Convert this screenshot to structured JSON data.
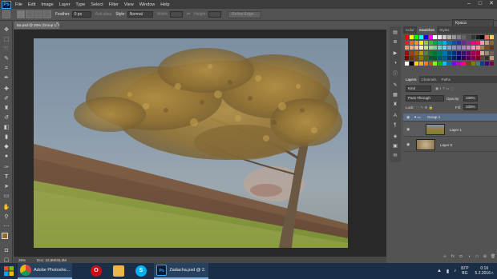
{
  "menubar": {
    "logo": "Ps",
    "items": [
      "File",
      "Edit",
      "Image",
      "Layer",
      "Type",
      "Select",
      "Filter",
      "View",
      "Window",
      "Help"
    ],
    "min": "–",
    "max": "□",
    "close": "✕"
  },
  "options": {
    "feather_label": "Feather:",
    "feather_value": "0 px",
    "antialias_label": "Anti-alias",
    "style_label": "Style:",
    "style_value": "Normal",
    "width_label": "Width:",
    "height_label": "Height:",
    "refine_edge": "Refine Edge...",
    "workspace": "Краса"
  },
  "document": {
    "tab_title": "Ба.psd @ 25% (Group 1, RGB/8)",
    "close": "×",
    "zoom": "25%",
    "doc_size": "Doc: 22,8M/45,3M"
  },
  "swatches_panel": {
    "tabs": [
      "Color",
      "Swatches",
      "Styles"
    ],
    "active": "Swatches",
    "colors": [
      "#ff0000",
      "#ffff00",
      "#00ff00",
      "#00ffff",
      "#0000ff",
      "#ff00ff",
      "#ffffff",
      "#e6e6e6",
      "#cccccc",
      "#b3b3b3",
      "#999999",
      "#808080",
      "#666666",
      "#4d4d4d",
      "#333333",
      "#1a1a1a",
      "#000000",
      "#ff6666",
      "#ffcc66",
      "#ed1c24",
      "#f26522",
      "#f7941d",
      "#fff200",
      "#8dc63f",
      "#39b54a",
      "#00a651",
      "#00a99d",
      "#00aeef",
      "#0072bc",
      "#0054a6",
      "#2e3192",
      "#662d91",
      "#92278f",
      "#ec008c",
      "#ed145b",
      "#f49ac1",
      "#c69c6d",
      "#8c6239",
      "#f69679",
      "#f9ad81",
      "#fdc689",
      "#fff799",
      "#c4df9b",
      "#a3d39c",
      "#82ca9d",
      "#7accc8",
      "#6dcff6",
      "#7da7d9",
      "#8393ca",
      "#8781bd",
      "#a186be",
      "#bd8cbf",
      "#f49ac2",
      "#f6989d",
      "#a67c52",
      "#754c24",
      "#603913",
      "#9e0b0f",
      "#a0410d",
      "#a3620a",
      "#aba000",
      "#598527",
      "#1a7b30",
      "#007236",
      "#00746b",
      "#0076a3",
      "#004a80",
      "#003471",
      "#1b1464",
      "#440e62",
      "#630460",
      "#9e005d",
      "#9e0039",
      "#c7b299",
      "#998675",
      "#736357",
      "#790000",
      "#7b2e00",
      "#7d4900",
      "#827b00",
      "#406618",
      "#005e20",
      "#005826",
      "#005952",
      "#005b7f",
      "#003663",
      "#002157",
      "#0d004c",
      "#32004b",
      "#4b0049",
      "#7b0046",
      "#7a0026",
      "#534741",
      "#362f2d",
      "#c69c6d",
      "#ffffff",
      "#000000",
      "#ffd200",
      "#e5b800",
      "#ff7e00",
      "#c45500",
      "#7fff00",
      "#00c000",
      "#00c0ff",
      "#0070c0",
      "#8000ff",
      "#c000c0",
      "#ff0080",
      "#804000",
      "#808000",
      "#408080",
      "#004080",
      "#400080",
      "#800040"
    ]
  },
  "layers_panel": {
    "tabs": [
      "Layers",
      "Channels",
      "Paths"
    ],
    "active": "Layers",
    "kind": "Kind",
    "blend_mode": "Pass Through",
    "opacity_label": "Opacity:",
    "opacity_value": "100%",
    "lock_label": "Lock:",
    "fill_label": "Fill:",
    "fill_value": "100%",
    "layers": [
      {
        "name": "Group 1",
        "type": "group"
      },
      {
        "name": "Layer 1",
        "type": "layer"
      },
      {
        "name": "Layer 0",
        "type": "layer"
      }
    ]
  },
  "taskbar": {
    "items": [
      {
        "label": "Adobe Photosho...",
        "icon": "chrome-icon"
      },
      {
        "label": "",
        "icon": "opera-icon"
      },
      {
        "label": "",
        "icon": "folder-icon"
      },
      {
        "label": "",
        "icon": "skype-icon"
      },
      {
        "label": "Zadacha.psd @ 2...",
        "icon": "photoshop-icon"
      }
    ],
    "lang_top": "БГР",
    "lang_bottom": "BG",
    "time": "0:16",
    "date": "5.2.2016 г."
  }
}
